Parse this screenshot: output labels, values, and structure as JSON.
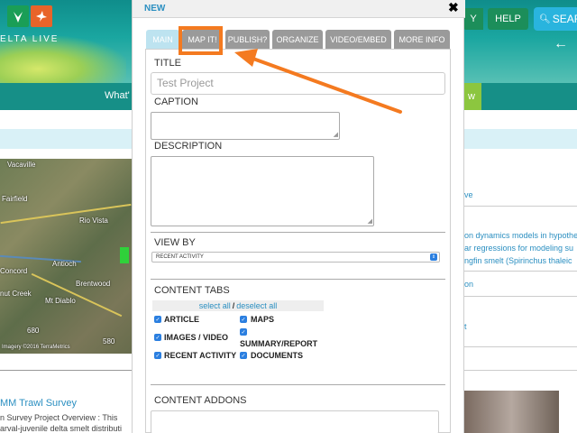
{
  "background": {
    "logo_text": "ELTA LIVE",
    "header_btn_partial": "Y",
    "help_label": "HELP",
    "search_label": "SEAR",
    "back_arrow": "←",
    "nav_text_partial": "What'",
    "nav_right_partial": "w",
    "map": {
      "labels": [
        "Vacaville",
        "Fairfield",
        "Rio Vista",
        "Antioch",
        "Concord",
        "Brentwood",
        "nut Creek",
        "Mt Diablo",
        "680",
        "580"
      ],
      "credit": "Imagery ©2016 TerraMetrics"
    },
    "article": {
      "title": "MM Trawl Survey",
      "line1": "n Survey Project Overview : This",
      "line2": "arval-juvenile delta smelt distributi"
    },
    "right_column": {
      "items": [
        "ve",
        "on dynamics models in hypothe",
        "ar regressions for modeling su",
        "ngfin smelt (Spirinchus thaleic",
        "on",
        "t"
      ]
    }
  },
  "modal": {
    "title": "NEW",
    "close_label": "✖",
    "tabs": [
      {
        "label": "MAIN"
      },
      {
        "label": "MAP IT!"
      },
      {
        "label": "PUBLISH?"
      },
      {
        "label": "ORGANIZE"
      },
      {
        "label": "VIDEO/EMBED"
      },
      {
        "label": "MORE INFO"
      }
    ],
    "title_label": "TITLE",
    "title_value": "Test Project",
    "caption_label": "CAPTION",
    "description_label": "DESCRIPTION",
    "view_by_label": "VIEW BY",
    "view_by_value": "RECENT ACTIVITY",
    "content_tabs_label": "CONTENT TABS",
    "select_all": "select all",
    "separator": "/",
    "deselect_all": "deselect all",
    "checkboxes": [
      {
        "label": "ARTICLE",
        "checked": true
      },
      {
        "label": "MAPS",
        "checked": true
      },
      {
        "label": "IMAGES / VIDEO",
        "checked": true
      },
      {
        "label": "SUMMARY/REPORT",
        "checked": true
      },
      {
        "label": "RECENT ACTIVITY",
        "checked": true
      },
      {
        "label": "DOCUMENTS",
        "checked": true
      }
    ],
    "content_addons_label": "CONTENT ADDONS"
  },
  "colors": {
    "accent": "#2b8fc1",
    "annotation": "#f47a20",
    "checkbox": "#2b7fe0",
    "tab_active": "#bde3f0",
    "tab_inactive": "#9a9a9a"
  }
}
